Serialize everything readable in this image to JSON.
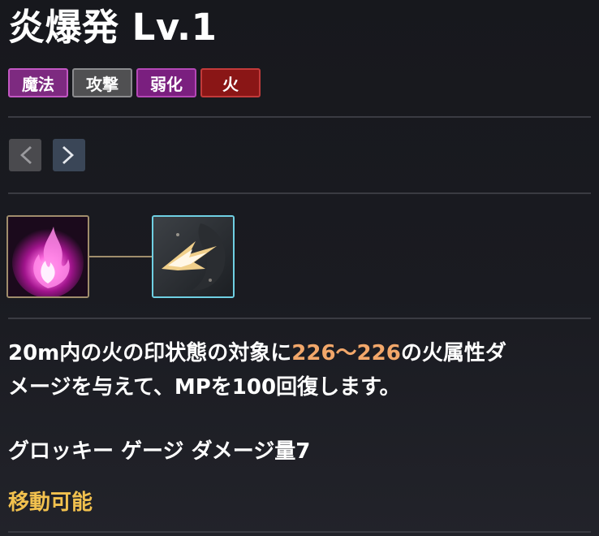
{
  "skill": {
    "title": "炎爆発 Lv.1",
    "tags": [
      {
        "label": "魔法",
        "type": "magic"
      },
      {
        "label": "攻撃",
        "type": "attack"
      },
      {
        "label": "弱化",
        "type": "weaken"
      },
      {
        "label": "火",
        "type": "fire"
      }
    ]
  },
  "navigation": {
    "prev_icon": "chevron-left-icon",
    "next_icon": "chevron-right-icon"
  },
  "skill_tree": {
    "nodes": [
      {
        "icon": "pink-flame-skill-icon",
        "state": "learned"
      },
      {
        "icon": "fire-explosion-skill-icon",
        "state": "selected"
      }
    ]
  },
  "description": {
    "line1_pre": "20m内の火の印状態の対象に",
    "damage": "226～226",
    "line1_post": "の火属性ダ",
    "line2": "メージを与えて、MPを100回復します。"
  },
  "groggy": "グロッキー ゲージ ダメージ量7",
  "mobility": "移動可能",
  "colors": {
    "highlight": "#f2a76a",
    "mobility": "#f2c14e",
    "tag_magic": "#7d2a80",
    "tag_attack": "#505052",
    "tag_weaken": "#7a1f7f",
    "tag_fire": "#8a1616"
  }
}
